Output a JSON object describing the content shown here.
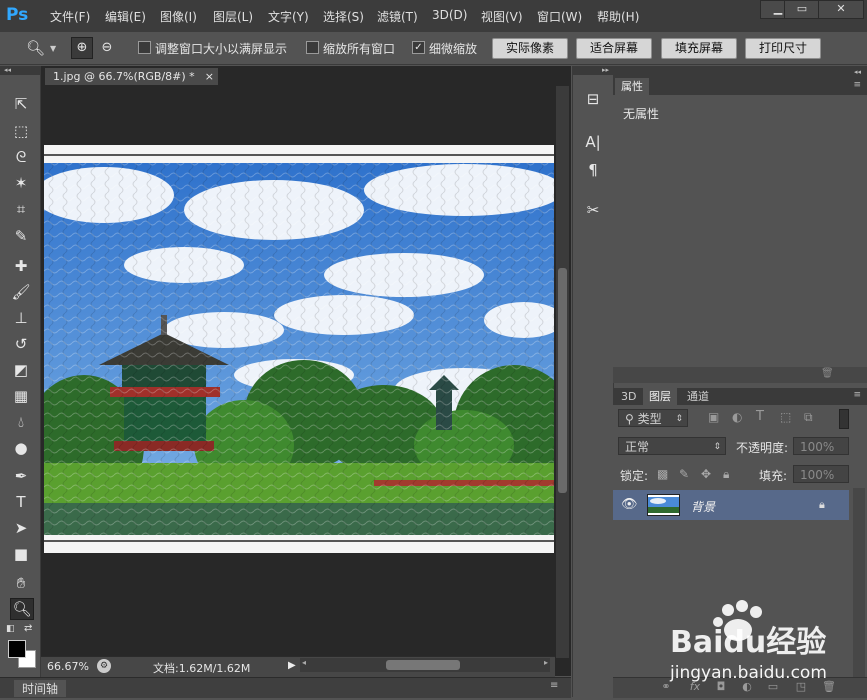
{
  "app": {
    "logo": "Ps"
  },
  "menu": [
    "文件(F)",
    "编辑(E)",
    "图像(I)",
    "图层(L)",
    "文字(Y)",
    "选择(S)",
    "滤镜(T)",
    "3D(D)",
    "视图(V)",
    "窗口(W)",
    "帮助(H)"
  ],
  "window_controls": {
    "minimize": "▁",
    "maximize": "▭",
    "close": "✕"
  },
  "options": {
    "checkbox1": "调整窗口大小以满屏显示",
    "checkbox2": "缩放所有窗口",
    "checkbox3": "细微缩放",
    "btn_actual": "实际像素",
    "btn_fit": "适合屏幕",
    "btn_fill": "填充屏幕",
    "btn_print": "打印尺寸"
  },
  "document": {
    "tab_title": "1.jpg @ 66.7%(RGB/8#) *",
    "tab_close": "×",
    "zoom": "66.67%",
    "doc_size": "文档:1.62M/1.62M"
  },
  "timeline": {
    "label": "时间轴"
  },
  "properties": {
    "tab": "属性",
    "content": "无属性"
  },
  "layers": {
    "tabs": [
      "3D",
      "图层",
      "通道"
    ],
    "filter_kind": "类型",
    "blend_mode": "正常",
    "opacity_label": "不透明度:",
    "opacity_value": "100%",
    "lock_label": "锁定:",
    "fill_label": "填充:",
    "fill_value": "100%",
    "layer_name": "背景"
  },
  "watermark": {
    "brand": "Baidu经验",
    "url": "jingyan.baidu.com"
  },
  "colors": {
    "accent": "#31a8ff",
    "layer_selected": "#57698a",
    "panel": "#535353",
    "sky": "#3f83d9"
  }
}
